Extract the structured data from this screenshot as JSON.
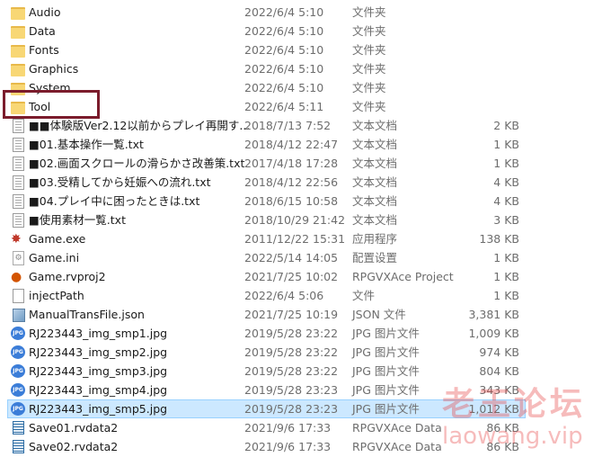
{
  "files": [
    {
      "name": "Audio",
      "date": "2022/6/4 5:10",
      "type": "文件夹",
      "size": "",
      "icon": "folder-icon"
    },
    {
      "name": "Data",
      "date": "2022/6/4 5:10",
      "type": "文件夹",
      "size": "",
      "icon": "folder-icon"
    },
    {
      "name": "Fonts",
      "date": "2022/6/4 5:10",
      "type": "文件夹",
      "size": "",
      "icon": "folder-icon"
    },
    {
      "name": "Graphics",
      "date": "2022/6/4 5:10",
      "type": "文件夹",
      "size": "",
      "icon": "folder-icon"
    },
    {
      "name": "System",
      "date": "2022/6/4 5:10",
      "type": "文件夹",
      "size": "",
      "icon": "folder-icon"
    },
    {
      "name": "Tool",
      "date": "2022/6/4 5:11",
      "type": "文件夹",
      "size": "",
      "icon": "folder-icon"
    },
    {
      "name": "■■体験版Ver2.12以前からプレイ再開す...",
      "date": "2018/7/13 7:52",
      "type": "文本文档",
      "size": "2 KB",
      "icon": "text-file-icon"
    },
    {
      "name": "■01.基本操作一覧.txt",
      "date": "2018/4/12 22:47",
      "type": "文本文档",
      "size": "1 KB",
      "icon": "text-file-icon"
    },
    {
      "name": "■02.画面スクロールの滑らかさ改善策.txt",
      "date": "2017/4/18 17:28",
      "type": "文本文档",
      "size": "1 KB",
      "icon": "text-file-icon"
    },
    {
      "name": "■03.受精してから妊娠への流れ.txt",
      "date": "2018/4/12 22:56",
      "type": "文本文档",
      "size": "4 KB",
      "icon": "text-file-icon"
    },
    {
      "name": "■04.プレイ中に困ったときは.txt",
      "date": "2018/6/15 10:58",
      "type": "文本文档",
      "size": "4 KB",
      "icon": "text-file-icon"
    },
    {
      "name": "■使用素材一覧.txt",
      "date": "2018/10/29 21:42",
      "type": "文本文档",
      "size": "3 KB",
      "icon": "text-file-icon"
    },
    {
      "name": "Game.exe",
      "date": "2011/12/22 15:31",
      "type": "应用程序",
      "size": "138 KB",
      "icon": "exe-icon"
    },
    {
      "name": "Game.ini",
      "date": "2022/5/14 14:05",
      "type": "配置设置",
      "size": "1 KB",
      "icon": "ini-file-icon"
    },
    {
      "name": "Game.rvproj2",
      "date": "2021/7/25 10:02",
      "type": "RPGVXAce Project",
      "size": "1 KB",
      "icon": "project-file-icon"
    },
    {
      "name": "injectPath",
      "date": "2022/6/4 5:06",
      "type": "文件",
      "size": "1 KB",
      "icon": "blank-file-icon"
    },
    {
      "name": "ManualTransFile.json",
      "date": "2021/7/25 10:19",
      "type": "JSON 文件",
      "size": "3,381 KB",
      "icon": "json-file-icon"
    },
    {
      "name": "RJ223443_img_smp1.jpg",
      "date": "2019/5/28 23:22",
      "type": "JPG 图片文件",
      "size": "1,009 KB",
      "icon": "jpg-file-icon"
    },
    {
      "name": "RJ223443_img_smp2.jpg",
      "date": "2019/5/28 23:22",
      "type": "JPG 图片文件",
      "size": "974 KB",
      "icon": "jpg-file-icon"
    },
    {
      "name": "RJ223443_img_smp3.jpg",
      "date": "2019/5/28 23:22",
      "type": "JPG 图片文件",
      "size": "804 KB",
      "icon": "jpg-file-icon"
    },
    {
      "name": "RJ223443_img_smp4.jpg",
      "date": "2019/5/28 23:23",
      "type": "JPG 图片文件",
      "size": "343 KB",
      "icon": "jpg-file-icon"
    },
    {
      "name": "RJ223443_img_smp5.jpg",
      "date": "2019/5/28 23:23",
      "type": "JPG 图片文件",
      "size": "1,012 KB",
      "icon": "jpg-file-icon",
      "selected": true
    },
    {
      "name": "Save01.rvdata2",
      "date": "2021/9/6 17:33",
      "type": "RPGVXAce Data",
      "size": "86 KB",
      "icon": "save-file-icon"
    },
    {
      "name": "Save02.rvdata2",
      "date": "2021/9/6 17:33",
      "type": "RPGVXAce Data",
      "size": "86 KB",
      "icon": "save-file-icon"
    }
  ],
  "highlight": {
    "target": "Tool",
    "color": "#7b1c2c"
  },
  "selection_color": "#cce8ff",
  "watermark": {
    "line1": "老王论坛",
    "line2": "laowang.vip"
  }
}
